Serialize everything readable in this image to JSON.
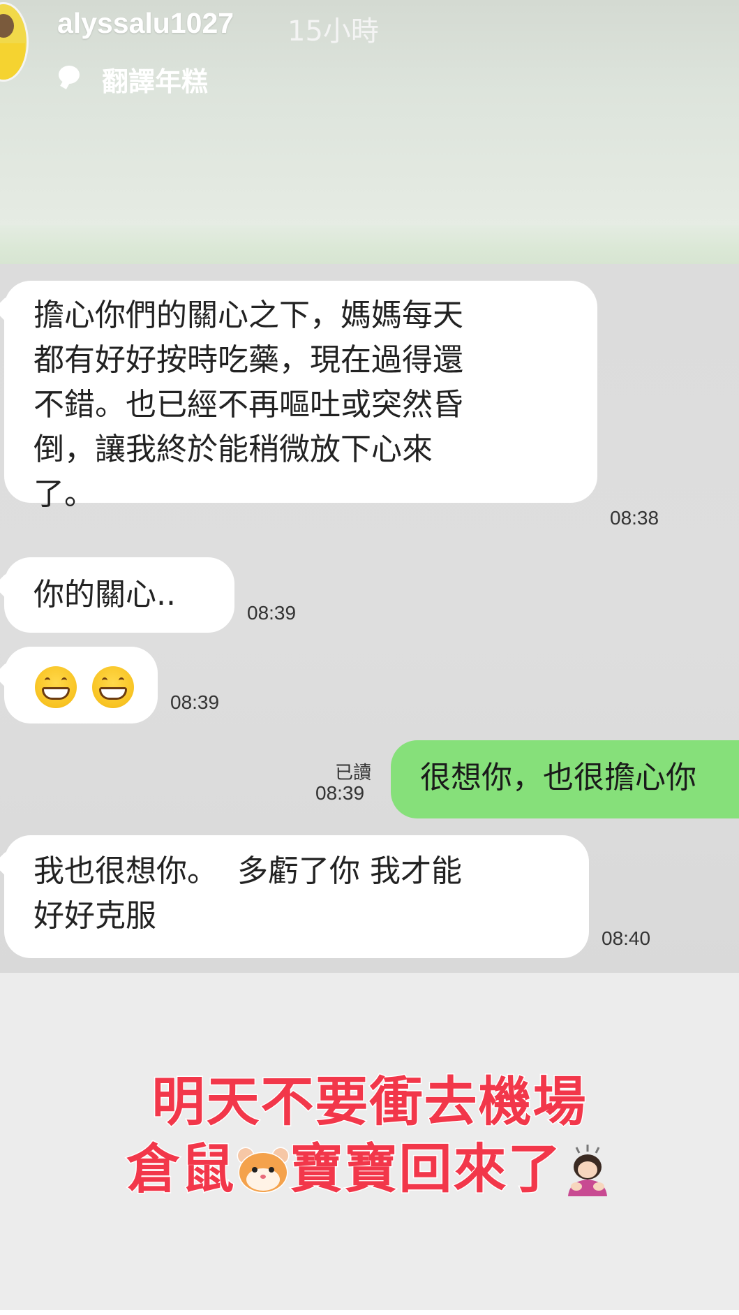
{
  "header": {
    "username": "alyssalu1027",
    "time_ago": "15小時",
    "music_label": "翻譯年糕"
  },
  "messages": [
    {
      "side": "left",
      "text": "擔心你們的關心之下，媽媽每天都有好好按時吃藥，現在過得還不錯。也已經不再嘔吐或突然昏倒，讓我終於能稍微放下心來了。",
      "lines": [
        "擔心你們的關心之下，媽媽每天",
        "都有好好按時吃藥，現在過得還",
        "不錯。也已經不再嘔吐或突然昏",
        "倒，讓我終於能稍微放下心來",
        "了。"
      ],
      "time": "08:38"
    },
    {
      "side": "left",
      "text": "你的關心..",
      "time": "08:39"
    },
    {
      "side": "left",
      "emoji": "grinning-face-with-smiling-eyes x2",
      "time": "08:39"
    },
    {
      "side": "right",
      "text": "很想你，也很擔心你",
      "visible_text": "很想你，也很擔心你",
      "read_label": "已讀",
      "time": "08:39"
    },
    {
      "side": "left",
      "lines": [
        "我也很想你。  多虧了你 我才能",
        "好好克服"
      ],
      "time": "08:40"
    }
  ],
  "caption": {
    "line1": "明天不要衝去機場",
    "line2_part1": "倉鼠",
    "line2_part2": "寶寶回來了",
    "color": "#f2374a"
  },
  "colors": {
    "sent_bubble": "#86e07a",
    "received_bubble": "#ffffff"
  }
}
